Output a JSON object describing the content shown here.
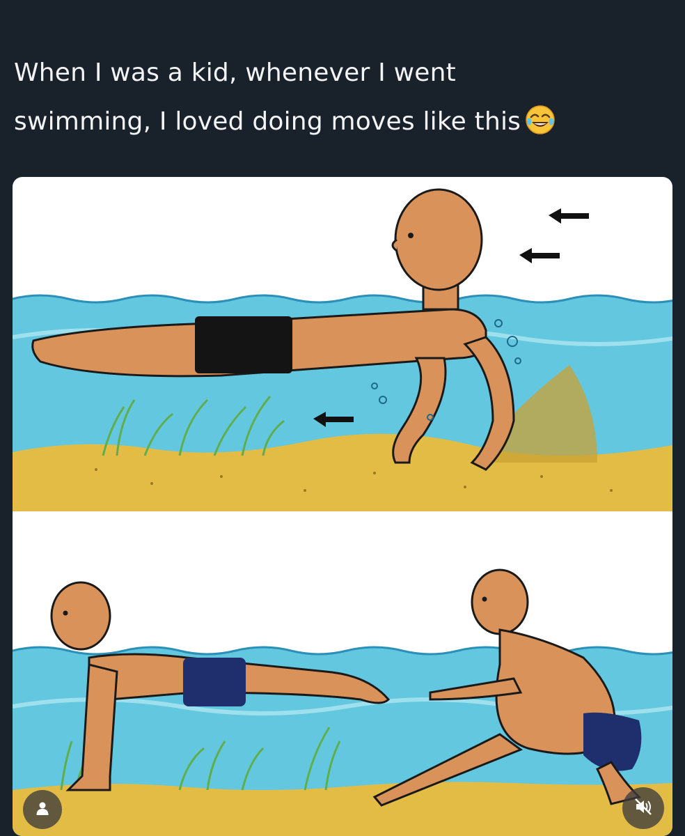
{
  "post": {
    "caption_line1": "When I was a kid, whenever I went",
    "caption_line2": "swimming, I loved doing moves like this",
    "emoji": "joy-emoji"
  },
  "image": {
    "alt_icon_top": "illustration-swimmer-walking-on-hands",
    "alt_icon_bottom": "illustration-swimmer-crawling-and-squatting"
  },
  "controls": {
    "profile_icon": "person-icon",
    "mute_icon": "speaker-muted-icon"
  },
  "colors": {
    "background": "#19212b",
    "caption": "#f3f4f6",
    "water": "#5ec7e0",
    "sand": "#e2b83a",
    "skin": "#d9925a",
    "trunks_top": "#141414",
    "trunks_bottom": "#1f2f6e"
  }
}
